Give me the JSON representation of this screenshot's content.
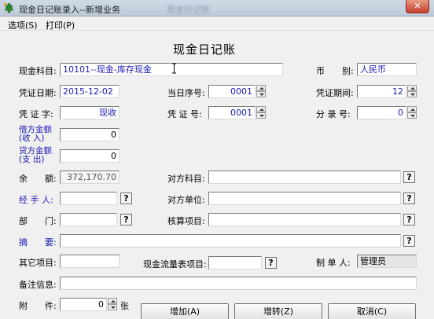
{
  "window": {
    "title": "现金日记账录入--新增业务",
    "ghost_title": "现金日记账",
    "close_glyph": "✕"
  },
  "menu": {
    "items": [
      "选项(S)",
      "打印(P)"
    ]
  },
  "form": {
    "title": "现金日记账",
    "cash_account": {
      "label": "现金科目:",
      "value": "10101--现金-库存现金"
    },
    "currency": {
      "label": "币　　别:",
      "value": "人民币"
    },
    "voucher_date": {
      "label": "凭证日期:",
      "value": "2015-12-02"
    },
    "daily_seq": {
      "label": "当日序号:",
      "value": "0001"
    },
    "voucher_period": {
      "label": "凭证期间:",
      "value": "12"
    },
    "voucher_word": {
      "label": "凭 证 字:",
      "value": "现收"
    },
    "voucher_no": {
      "label": "凭 证 号:",
      "value": "0001"
    },
    "entry_no": {
      "label": "分 录 号:",
      "value": "0"
    },
    "debit_amount": {
      "label_line1": "借方金额",
      "label_line2": "(收  入)",
      "value": "0"
    },
    "credit_amount": {
      "label_line1": "贷方金额",
      "label_line2": "(支  出)",
      "value": "0"
    },
    "balance": {
      "label": "余　　额:",
      "value": "372,170.70"
    },
    "counter_account": {
      "label": "对方科目:",
      "value": ""
    },
    "handler": {
      "label": "经 手 人:",
      "value": ""
    },
    "counter_unit": {
      "label": "对方单位:",
      "value": ""
    },
    "department": {
      "label": "部　　门:",
      "value": ""
    },
    "accounting_item": {
      "label": "核算项目:",
      "value": ""
    },
    "summary": {
      "label": "摘　　要:",
      "value": ""
    },
    "other_item": {
      "label": "其它项目:",
      "value": ""
    },
    "cashflow_item": {
      "label": "现金流量表项目:",
      "value": ""
    },
    "maker": {
      "label": "制 单 人:",
      "value": "管理员"
    },
    "remarks": {
      "label": "备注信息:",
      "value": ""
    },
    "attachments": {
      "label": "附　　件:",
      "value": "0",
      "unit": "张"
    }
  },
  "lookup_glyph": "?",
  "buttons": {
    "add": "增加(A)",
    "transfer": "增转(Z)",
    "cancel": "取消(C)"
  },
  "colors": {
    "label_blue": "#1a1ab4",
    "titlebar": "#c8d3e1",
    "close_red": "#c8402a"
  }
}
